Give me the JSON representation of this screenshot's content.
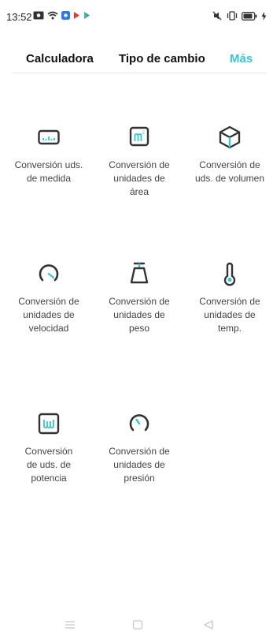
{
  "status_bar": {
    "time": "13:52",
    "icons_left": [
      "photo-icon",
      "wifi-icon",
      "app-notification-icon",
      "play-red-icon",
      "play-store-icon"
    ],
    "icons_right": [
      "mute-vibrate-icon",
      "vibrate-icon",
      "battery-icon",
      "charging-icon"
    ]
  },
  "tabs": [
    {
      "label": "Calculadora",
      "active": false
    },
    {
      "label": "Tipo de cambio",
      "active": false
    },
    {
      "label": "Más",
      "active": true
    }
  ],
  "accent_color": "#35c8d2",
  "tools": [
    {
      "icon": "ruler-icon",
      "line1": "Conversión uds.",
      "line2": "de medida",
      "line3": ""
    },
    {
      "icon": "area-icon",
      "line1": "Conversión de",
      "line2": "unidades de",
      "line3": "área"
    },
    {
      "icon": "volume-cube-icon",
      "line1": "Conversión de",
      "line2": "uds. de volumen",
      "line3": ""
    },
    {
      "icon": "speedometer-icon",
      "line1": "Conversión de",
      "line2": "unidades de",
      "line3": "velocidad"
    },
    {
      "icon": "weight-icon",
      "line1": "Conversión de",
      "line2": "unidades de",
      "line3": "peso"
    },
    {
      "icon": "thermometer-icon",
      "line1": "Conversión de",
      "line2": "unidades de",
      "line3": "temp."
    },
    {
      "icon": "power-icon",
      "line1": "Conversión",
      "line2": "de uds. de",
      "line3": "potencia"
    },
    {
      "icon": "pressure-gauge-icon",
      "line1": "Conversión de",
      "line2": "unidades de",
      "line3": "presión"
    }
  ],
  "nav_bar": [
    "menu-icon",
    "home-icon",
    "back-icon"
  ]
}
